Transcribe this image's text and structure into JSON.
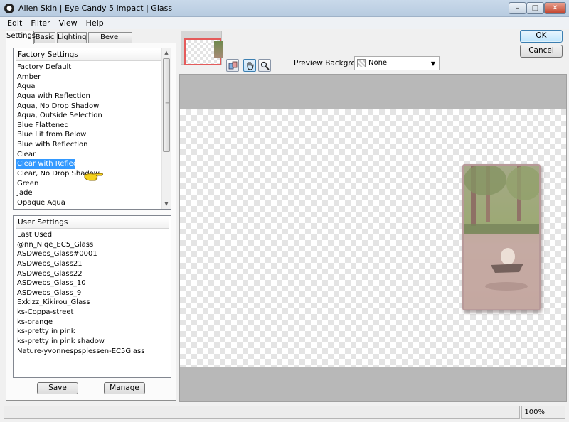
{
  "window": {
    "title": "Alien Skin | Eye Candy 5 Impact | Glass",
    "controls": {
      "minimize": "–",
      "maximize": "□",
      "close": "✕"
    }
  },
  "menu": [
    "Edit",
    "Filter",
    "View",
    "Help"
  ],
  "tabs": [
    "Settings",
    "Basic",
    "Lighting",
    "Bevel Profile"
  ],
  "active_tab": "Settings",
  "factory_settings": {
    "header": "Factory Settings",
    "items": [
      "Factory Default",
      "Amber",
      "Aqua",
      "Aqua with Reflection",
      "Aqua, No Drop Shadow",
      "Aqua, Outside Selection",
      "Blue Flattened",
      "Blue Lit from Below",
      "Blue with Reflection",
      "Clear",
      "Clear with Reflection",
      "Clear, No Drop Shadow",
      "Green",
      "Jade",
      "Opaque Aqua"
    ],
    "selected": "Clear with Reflection"
  },
  "user_settings": {
    "header": "User Settings",
    "items": [
      "Last Used",
      "@nn_Niqe_EC5_Glass",
      "ASDwebs_Glass#0001",
      "ASDwebs_Glass21",
      "ASDwebs_Glass22",
      "ASDwebs_Glass_10",
      "ASDwebs_Glass_9",
      "Exkizz_Kikirou_Glass",
      "ks-Coppa-street",
      "ks-orange",
      "ks-pretty in pink",
      "ks-pretty in pink shadow",
      "Nature-yvonnespsplessen-EC5Glass"
    ]
  },
  "buttons": {
    "save": "Save",
    "manage": "Manage",
    "ok": "OK",
    "cancel": "Cancel"
  },
  "preview_background": {
    "label": "Preview Background:",
    "value": "None"
  },
  "status": {
    "zoom": "100%"
  },
  "colors": {
    "selection": "#3399ff",
    "thumbnail_frame": "#e45a5a",
    "preview_gray": "#b8b8b8"
  },
  "icons": [
    "app-logo-icon",
    "preview-toggle-icon",
    "hand-pan-icon",
    "zoom-magnifier-icon",
    "pointing-hand-icon",
    "dropdown-arrow-icon"
  ]
}
